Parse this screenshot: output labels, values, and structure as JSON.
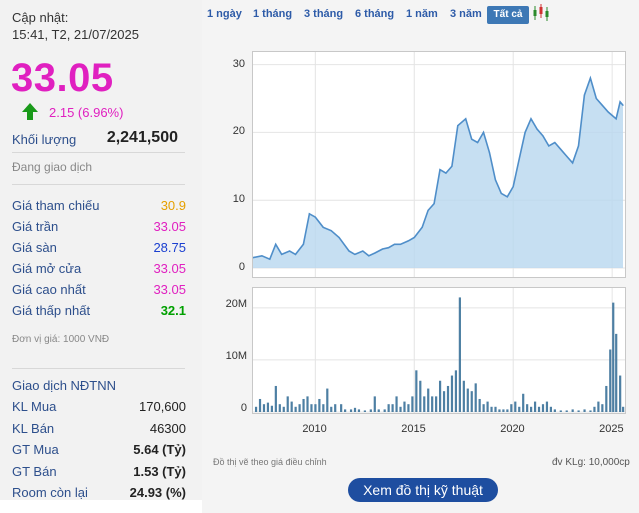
{
  "stock": {
    "updated_label": "Cập nhật:",
    "updated_time": "15:41, T2, 21/07/2025",
    "price": "33.05",
    "change": "2.15 (6.96%)",
    "volume_label": "Khối lượng",
    "volume_value": "2,241,500",
    "status": "Đang giao dịch",
    "prices": [
      {
        "label": "Giá tham chiếu",
        "value": "30.9",
        "color": "#e6a000"
      },
      {
        "label": "Giá trần",
        "value": "33.05",
        "color": "#e020c0"
      },
      {
        "label": "Giá sàn",
        "value": "28.75",
        "color": "#1a3fd0"
      },
      {
        "label": "Giá mở cửa",
        "value": "33.05",
        "color": "#e020c0"
      },
      {
        "label": "Giá cao nhất",
        "value": "33.05",
        "color": "#e020c0"
      },
      {
        "label": "Giá thấp nhất",
        "value": "32.1",
        "color": "#00a000"
      }
    ],
    "unit_note": "Đơn vị giá: 1000 VNĐ"
  },
  "foreign": {
    "title": "Giao dịch NĐTNN",
    "rows": [
      {
        "label": "KL Mua",
        "value": "170,600"
      },
      {
        "label": "KL Bán",
        "value": "46300"
      },
      {
        "label": "GT Mua",
        "value": "5.64 (Tỷ)"
      },
      {
        "label": "GT Bán",
        "value": "1.53 (Tỷ)"
      },
      {
        "label": "Room còn lại",
        "value": "24.93 (%)"
      }
    ]
  },
  "periods": [
    "1 ngày",
    "1 tháng",
    "3 tháng",
    "6 tháng",
    "1 năm",
    "3 năm"
  ],
  "period_active": "Tất cả",
  "chart_note_left": "Đồ thị vẽ theo giá điều chỉnh",
  "chart_note_right": "đv KLg: 10,000cp",
  "tech_button": "Xem đồ thị kỹ thuật",
  "colors": {
    "accent": "#e020c0",
    "line": "#4f8ec9",
    "area": "#b8d7ef",
    "bar": "#4d7fa3",
    "button": "#1e4ea0"
  },
  "chart_data": [
    {
      "type": "area",
      "title": "",
      "ylim": [
        0,
        32
      ],
      "yticks": [
        0,
        10,
        20,
        30
      ],
      "xticks": [
        2010,
        2015,
        2020,
        2025
      ],
      "xlim": [
        2006.8,
        2025.7
      ],
      "x": [
        2006.8,
        2007.3,
        2007.7,
        2008.0,
        2008.3,
        2008.7,
        2009.0,
        2009.4,
        2009.7,
        2010.0,
        2010.4,
        2010.8,
        2011.2,
        2011.7,
        2012.0,
        2012.4,
        2012.7,
        2013.0,
        2013.4,
        2013.7,
        2014.0,
        2014.3,
        2014.7,
        2015.0,
        2015.4,
        2015.7,
        2016.0,
        2016.3,
        2016.6,
        2016.9,
        2017.2,
        2017.6,
        2017.9,
        2018.2,
        2018.5,
        2018.8,
        2019.1,
        2019.4,
        2019.7,
        2020.0,
        2020.3,
        2020.6,
        2020.9,
        2021.2,
        2021.5,
        2021.8,
        2022.1,
        2022.4,
        2022.7,
        2023.0,
        2023.3,
        2023.6,
        2023.9,
        2024.2,
        2024.5,
        2024.8,
        2025.0,
        2025.2,
        2025.4,
        2025.55
      ],
      "y": [
        1.5,
        1.8,
        1.3,
        3.5,
        2.0,
        2.5,
        2.0,
        3.5,
        8.0,
        7.5,
        6.0,
        5.5,
        4.5,
        2.5,
        2.0,
        2.5,
        1.8,
        2.2,
        2.8,
        3.0,
        3.5,
        3.5,
        4.0,
        4.5,
        6.0,
        8.5,
        9.5,
        14.5,
        14.0,
        15.0,
        21.0,
        22.0,
        19.0,
        18.5,
        20.0,
        17.0,
        13.0,
        11.0,
        10.5,
        12.0,
        16.0,
        20.0,
        22.0,
        20.5,
        19.5,
        18.0,
        18.5,
        17.5,
        16.5,
        15.5,
        18.0,
        25.5,
        28.0,
        25.0,
        24.0,
        23.0,
        22.5,
        22.0,
        24.5,
        24.0
      ]
    },
    {
      "type": "bar",
      "title": "",
      "ylim": [
        0,
        24
      ],
      "yticks": [
        "0",
        "10M",
        "20M"
      ],
      "ytick_values": [
        0,
        10,
        20
      ],
      "xlim": [
        2006.8,
        2025.7
      ],
      "x": [
        2007.0,
        2007.2,
        2007.4,
        2007.6,
        2007.8,
        2008.0,
        2008.2,
        2008.4,
        2008.6,
        2008.8,
        2009.0,
        2009.2,
        2009.4,
        2009.6,
        2009.8,
        2010.0,
        2010.2,
        2010.4,
        2010.6,
        2010.8,
        2011.0,
        2011.3,
        2011.5,
        2011.8,
        2012.0,
        2012.2,
        2012.5,
        2012.8,
        2013.0,
        2013.2,
        2013.5,
        2013.7,
        2013.9,
        2014.1,
        2014.3,
        2014.5,
        2014.7,
        2014.9,
        2015.1,
        2015.3,
        2015.5,
        2015.7,
        2015.9,
        2016.1,
        2016.3,
        2016.5,
        2016.7,
        2016.9,
        2017.1,
        2017.3,
        2017.5,
        2017.7,
        2017.9,
        2018.1,
        2018.3,
        2018.5,
        2018.7,
        2018.9,
        2019.1,
        2019.3,
        2019.5,
        2019.7,
        2019.9,
        2020.1,
        2020.3,
        2020.5,
        2020.7,
        2020.9,
        2021.1,
        2021.3,
        2021.5,
        2021.7,
        2021.9,
        2022.1,
        2022.4,
        2022.7,
        2023.0,
        2023.3,
        2023.6,
        2023.9,
        2024.1,
        2024.3,
        2024.5,
        2024.7,
        2024.9,
        2025.05,
        2025.2,
        2025.4,
        2025.55
      ],
      "values": [
        1.0,
        2.5,
        1.5,
        1.8,
        1.2,
        5.0,
        1.5,
        1.0,
        3.0,
        2.0,
        1.0,
        1.5,
        2.5,
        3.0,
        1.5,
        1.5,
        2.5,
        1.5,
        4.5,
        1.0,
        1.5,
        1.5,
        0.5,
        0.5,
        0.8,
        0.5,
        0.3,
        0.5,
        3.0,
        0.5,
        0.5,
        1.5,
        1.5,
        3.0,
        1.0,
        2.0,
        1.5,
        3.0,
        8.0,
        6.0,
        3.0,
        4.5,
        3.0,
        3.0,
        6.0,
        4.0,
        5.0,
        7.0,
        8.0,
        22.0,
        6.0,
        4.5,
        4.0,
        5.5,
        2.5,
        1.5,
        2.0,
        1.0,
        1.0,
        0.5,
        0.5,
        0.5,
        1.5,
        2.0,
        1.0,
        3.5,
        1.5,
        1.0,
        2.0,
        1.0,
        1.5,
        2.0,
        1.0,
        0.5,
        0.3,
        0.3,
        0.5,
        0.3,
        0.5,
        0.3,
        1.0,
        2.0,
        1.5,
        5.0,
        12.0,
        21.0,
        15.0,
        7.0,
        1.0
      ]
    }
  ]
}
